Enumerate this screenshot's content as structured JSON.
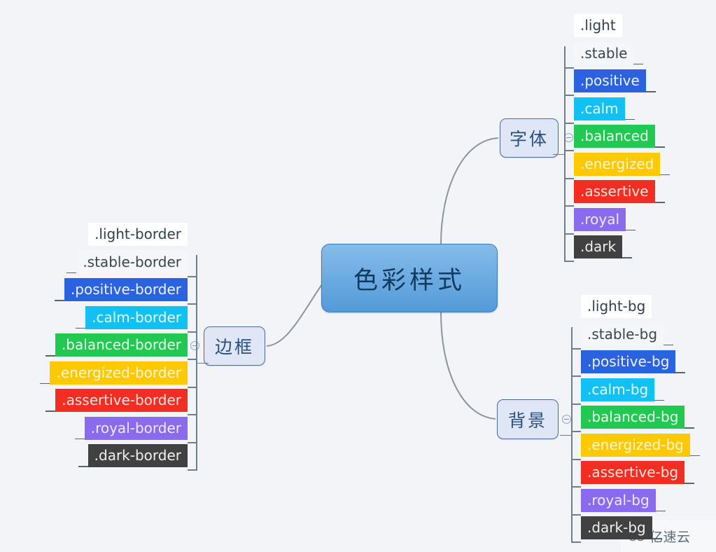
{
  "background_color": "#f2f4f7",
  "root": {
    "label": "色彩样式",
    "fill_from": "#85bce9",
    "fill_to": "#539ad9",
    "border_color": "#3e7cb5",
    "text_color": "#123a5e"
  },
  "branches": [
    {
      "id": "font",
      "label": "字体",
      "side": "right",
      "fill": "#dfe7f7",
      "border_color": "#4a6e9e",
      "text_color": "#2b4f80",
      "collapse_toggle": "collapse-toggle-icon",
      "leaves": [
        {
          "label": ".light",
          "bg": "#ffffff",
          "fg": "#313f4d"
        },
        {
          "label": ".stable",
          "bg": "#f4f6f8",
          "fg": "#3a4550"
        },
        {
          "label": ".positive",
          "bg": "#2a62e0",
          "fg": "#eef3ff"
        },
        {
          "label": ".calm",
          "bg": "#11c1f3",
          "fg": "#e8fbff"
        },
        {
          "label": ".balanced",
          "bg": "#22c950",
          "fg": "#eafff0"
        },
        {
          "label": ".energized",
          "bg": "#ffc900",
          "fg": "#fff6d9"
        },
        {
          "label": ".assertive",
          "bg": "#f42d22",
          "fg": "#ffe4e2"
        },
        {
          "label": ".royal",
          "bg": "#8a6bee",
          "fg": "#efe9ff"
        },
        {
          "label": ".dark",
          "bg": "#414141",
          "fg": "#f0f0f0"
        }
      ]
    },
    {
      "id": "background",
      "label": "背景",
      "side": "right",
      "fill": "#dfe7f7",
      "border_color": "#4a6e9e",
      "text_color": "#2b4f80",
      "collapse_toggle": "collapse-toggle-icon",
      "leaves": [
        {
          "label": ".light-bg",
          "bg": "#ffffff",
          "fg": "#313f4d"
        },
        {
          "label": ".stable-bg",
          "bg": "#f4f6f8",
          "fg": "#3a4550"
        },
        {
          "label": ".positive-bg",
          "bg": "#2a62e0",
          "fg": "#eef3ff"
        },
        {
          "label": ".calm-bg",
          "bg": "#11c1f3",
          "fg": "#e8fbff"
        },
        {
          "label": ".balanced-bg",
          "bg": "#22c950",
          "fg": "#eafff0"
        },
        {
          "label": ".energized-bg",
          "bg": "#ffc900",
          "fg": "#fff6d9"
        },
        {
          "label": ".assertive-bg",
          "bg": "#f42d22",
          "fg": "#ffe4e2"
        },
        {
          "label": ".royal-bg",
          "bg": "#8a6bee",
          "fg": "#efe9ff"
        },
        {
          "label": ".dark-bg",
          "bg": "#414141",
          "fg": "#f0f0f0"
        }
      ]
    },
    {
      "id": "border",
      "label": "边框",
      "side": "left",
      "fill": "#dfe7f7",
      "border_color": "#4a6e9e",
      "text_color": "#2b4f80",
      "collapse_toggle": "collapse-toggle-icon",
      "leaves": [
        {
          "label": ".light-border",
          "bg": "#ffffff",
          "fg": "#313f4d"
        },
        {
          "label": ".stable-border",
          "bg": "#f4f6f8",
          "fg": "#3a4550"
        },
        {
          "label": ".positive-border",
          "bg": "#2a62e0",
          "fg": "#eef3ff"
        },
        {
          "label": ".calm-border",
          "bg": "#11c1f3",
          "fg": "#e8fbff"
        },
        {
          "label": ".balanced-border",
          "bg": "#22c950",
          "fg": "#eafff0"
        },
        {
          "label": ".energized-border",
          "bg": "#ffc900",
          "fg": "#fff6d9"
        },
        {
          "label": ".assertive-border",
          "bg": "#f42d22",
          "fg": "#ffe4e2"
        },
        {
          "label": ".royal-border",
          "bg": "#8a6bee",
          "fg": "#efe9ff"
        },
        {
          "label": ".dark-border",
          "bg": "#414141",
          "fg": "#f0f0f0"
        }
      ]
    }
  ],
  "watermark": {
    "text": "亿速云",
    "icon": "cloud-spiral-logo-icon"
  }
}
